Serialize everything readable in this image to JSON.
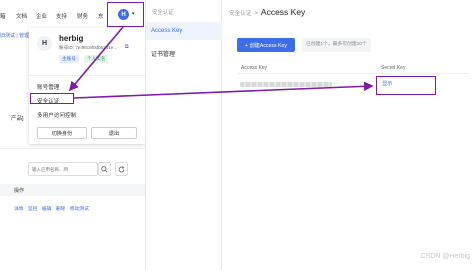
{
  "top_nav": {
    "items": [
      "箱",
      "文档",
      "企业",
      "支持",
      "财务",
      "东"
    ],
    "avatar_letter": "H"
  },
  "left_app": {
    "sub_link": "旧测试 | 管理",
    "product_fragment": "产品]",
    "search_placeholder": "输入应用名称、所",
    "op_header": "操作",
    "row_actions": [
      "详情",
      "监控",
      "编辑",
      "删除",
      "移动测试"
    ]
  },
  "dropdown": {
    "avatar_letter": "H",
    "username": "herbig",
    "account_id": "账号ID: 7e4f6c8f0db5241e...",
    "badge_main": "主账号",
    "badge_real": "个人实名",
    "menu": {
      "account_manage": "账号管理",
      "security_auth": "安全认证",
      "multi_user": "多用户访问控制"
    },
    "switch_identity": "切换身份",
    "logout": "退出"
  },
  "mid_sidebar": {
    "title": "安全认证",
    "items": [
      {
        "label": "Access Key",
        "active": true
      },
      {
        "label": "证书管理",
        "active": false
      }
    ]
  },
  "main": {
    "breadcrumb_parent": "安全认证",
    "breadcrumb_sep": ">",
    "breadcrumb_current": "Access Key",
    "create_button": "+ 创建Access Key",
    "limit_note": "已创建1个，最多可创建20个",
    "table": {
      "headers": [
        "Access Key",
        "Secret Key"
      ],
      "rows": [
        {
          "secret_key_action": "显示"
        }
      ]
    }
  },
  "watermark": "CSDN @Herbig",
  "colors": {
    "accent": "#3d6ee8",
    "annotation": "#7d1aa8"
  }
}
